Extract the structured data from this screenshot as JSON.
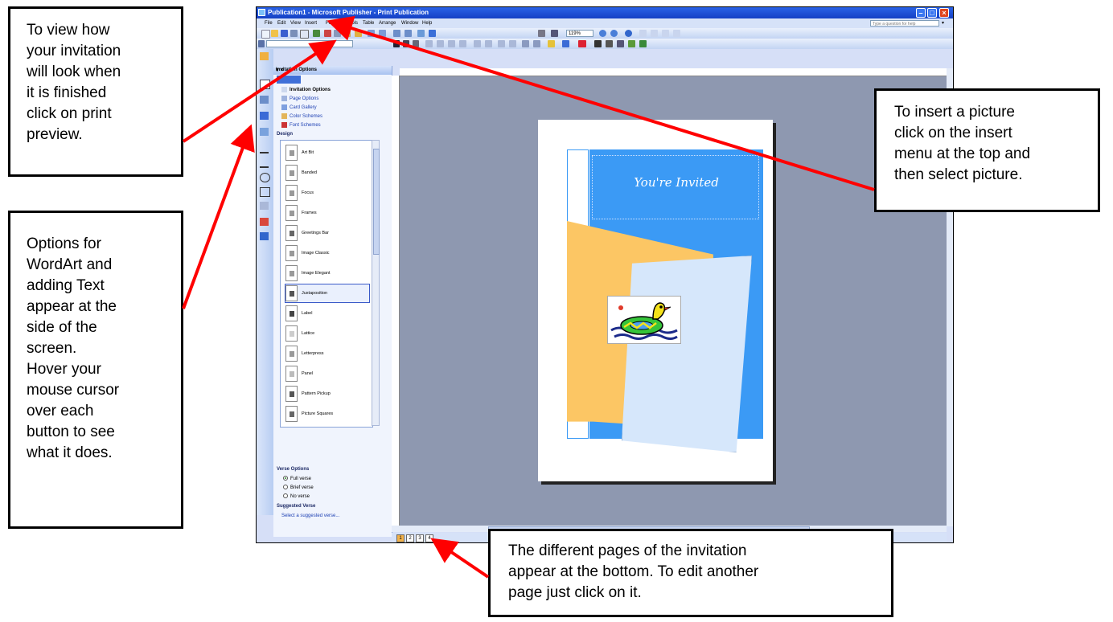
{
  "callouts": {
    "print_preview": "To view how\nyour invitation\nwill look when\nit is finished\nclick on print\npreview.",
    "task_pane": "Options for\nWordArt and\nadding Text\nappear at the\nside of the\nscreen.\nHover your\nmouse cursor\nover each\nbutton to see\nwhat it does.",
    "insert_picture": "To insert a picture\nclick on the insert\nmenu at the top and\nthen select picture.",
    "pages": "The different pages of the invitation\nappear at the bottom.  To edit another\npage just click on it."
  },
  "window": {
    "title": "Publication1 - Microsoft Publisher - Print Publication",
    "help_placeholder": "Type a question for help",
    "menu": [
      "File",
      "Edit",
      "View",
      "Insert",
      "Format",
      "Tools",
      "Table",
      "Arrange",
      "Window",
      "Help"
    ],
    "zoom": "119%"
  },
  "task_pane": {
    "title": "Invitation Options",
    "links": [
      "Invitation Options",
      "Page Options",
      "Card Gallery",
      "Color Schemes",
      "Font Schemes"
    ],
    "design_heading": "Design",
    "designs": [
      "Art Bit",
      "Banded",
      "Focus",
      "Frames",
      "Greetings Bar",
      "Image Classic",
      "Image Elegant",
      "Juxtaposition",
      "Label",
      "Lattice",
      "Letterpress",
      "Panel",
      "Pattern Pickup",
      "Picture Squares"
    ],
    "selected_design": "Juxtaposition",
    "verse_heading": "Verse Options",
    "verse_options": [
      "Full verse",
      "Brief verse",
      "No verse"
    ],
    "suggested_heading": "Suggested Verse",
    "suggested_link": "Select a suggested verse..."
  },
  "document": {
    "headline": "You're Invited",
    "pages": [
      "1",
      "2",
      "3",
      "4"
    ],
    "current_page": "1"
  },
  "colors": {
    "accent_blue": "#3b9af5",
    "accent_orange": "#fcc664",
    "arrow_red": "#ff0000"
  }
}
